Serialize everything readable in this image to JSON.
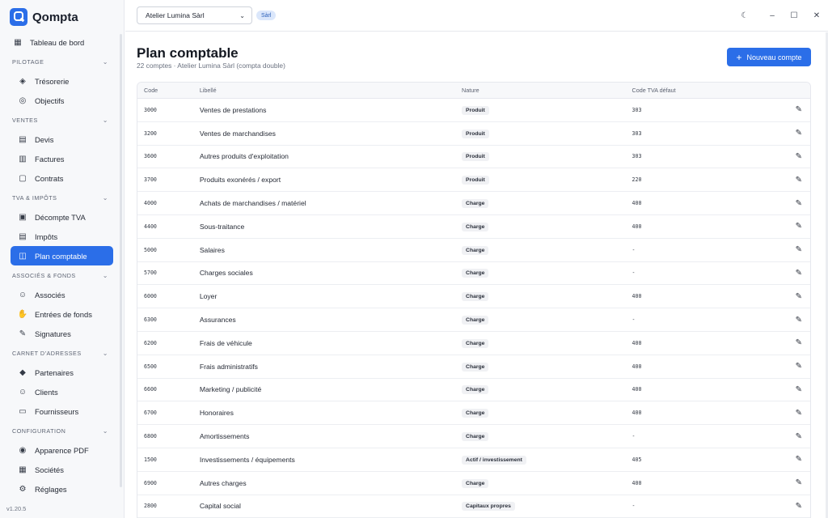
{
  "app": {
    "name": "Qompta",
    "version": "v1.20.5"
  },
  "topbar": {
    "company": "Atelier Lumina Sàrl",
    "legal_form": "Sàrl"
  },
  "sidebar": {
    "dashboard": "Tableau de bord",
    "groups": [
      {
        "title": "Pilotage",
        "items": [
          "Trésorerie",
          "Objectifs"
        ]
      },
      {
        "title": "Ventes",
        "items": [
          "Devis",
          "Factures",
          "Contrats"
        ]
      },
      {
        "title": "TVA & impôts",
        "items": [
          "Décompte TVA",
          "Impôts",
          "Plan comptable"
        ]
      },
      {
        "title": "Associés & fonds",
        "items": [
          "Associés",
          "Entrées de fonds",
          "Signatures"
        ]
      },
      {
        "title": "Carnet d'adresses",
        "items": [
          "Partenaires",
          "Clients",
          "Fournisseurs"
        ]
      },
      {
        "title": "Configuration",
        "items": [
          "Apparence PDF",
          "Sociétés",
          "Réglages"
        ]
      }
    ],
    "active": "Plan comptable"
  },
  "page": {
    "title": "Plan comptable",
    "subtitle": "22 comptes · Atelier Lumina Sàrl (compta double)",
    "new_button": "Nouveau compte"
  },
  "table": {
    "headers": {
      "code": "Code",
      "label": "Libellé",
      "nature": "Nature",
      "tva": "Code TVA défaut"
    },
    "rows": [
      {
        "code": "3000",
        "label": "Ventes de prestations",
        "nature": "Produit",
        "tva": "303"
      },
      {
        "code": "3200",
        "label": "Ventes de marchandises",
        "nature": "Produit",
        "tva": "303"
      },
      {
        "code": "3600",
        "label": "Autres produits d'exploitation",
        "nature": "Produit",
        "tva": "303"
      },
      {
        "code": "3700",
        "label": "Produits exonérés / export",
        "nature": "Produit",
        "tva": "220"
      },
      {
        "code": "4000",
        "label": "Achats de marchandises / matériel",
        "nature": "Charge",
        "tva": "400"
      },
      {
        "code": "4400",
        "label": "Sous-traitance",
        "nature": "Charge",
        "tva": "400"
      },
      {
        "code": "5000",
        "label": "Salaires",
        "nature": "Charge",
        "tva": "-"
      },
      {
        "code": "5700",
        "label": "Charges sociales",
        "nature": "Charge",
        "tva": "-"
      },
      {
        "code": "6000",
        "label": "Loyer",
        "nature": "Charge",
        "tva": "400"
      },
      {
        "code": "6300",
        "label": "Assurances",
        "nature": "Charge",
        "tva": "-"
      },
      {
        "code": "6200",
        "label": "Frais de véhicule",
        "nature": "Charge",
        "tva": "400"
      },
      {
        "code": "6500",
        "label": "Frais administratifs",
        "nature": "Charge",
        "tva": "400"
      },
      {
        "code": "6600",
        "label": "Marketing / publicité",
        "nature": "Charge",
        "tva": "400"
      },
      {
        "code": "6700",
        "label": "Honoraires",
        "nature": "Charge",
        "tva": "400"
      },
      {
        "code": "6800",
        "label": "Amortissements",
        "nature": "Charge",
        "tva": "-"
      },
      {
        "code": "1500",
        "label": "Investissements / équipements",
        "nature": "Actif / investissement",
        "tva": "405"
      },
      {
        "code": "6900",
        "label": "Autres charges",
        "nature": "Charge",
        "tva": "400"
      },
      {
        "code": "2800",
        "label": "Capital social",
        "nature": "Capitaux propres",
        "tva": "-"
      }
    ]
  },
  "colors": {
    "accent": "#2b6ee8",
    "sidebar_bg": "#f7f8fa",
    "border": "#e6e8ee"
  }
}
